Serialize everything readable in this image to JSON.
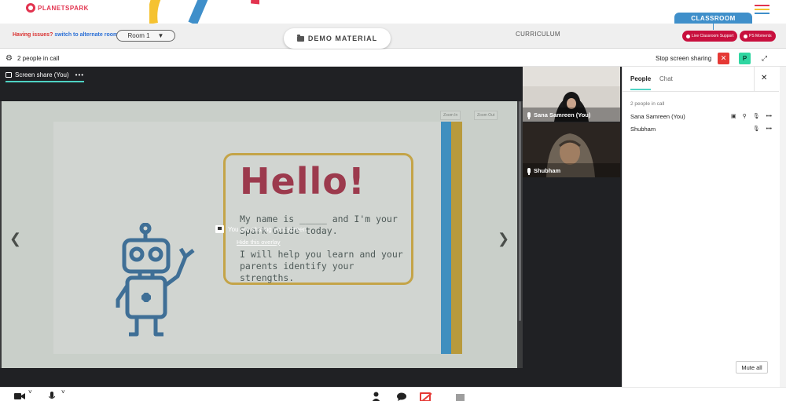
{
  "brand": {
    "name": "PLANETSPARK"
  },
  "colors": {
    "accent": "#4fd3c4",
    "brand_red": "#e2334f",
    "classroom_blue": "#3f8fca",
    "danger": "#e53935",
    "pill_red": "#c8103e",
    "stage_bg": "#202124"
  },
  "header": {
    "issues_text": "Having issues?",
    "switch_link": "switch to alternate room",
    "room_value": "Room 1",
    "room_chevron": "▼",
    "demo_material": "DEMO MATERIAL",
    "curriculum": "CURRICULUM",
    "classroom_tab": "CLASSROOM",
    "live_support": "Live Classroom Support",
    "ps_moments": "PS Moments",
    "menu_icon": "hamburger-icon"
  },
  "callbar": {
    "settings_icon": "⚙",
    "people_count": "2 people in call",
    "stop_sharing": "Stop screen sharing",
    "stop_x": "✕",
    "avatar_letter": "P",
    "expand_icon": "⤢"
  },
  "stage": {
    "tab_label": "Screen share (You)",
    "tab_more": "•••",
    "zoom_in": "Zoom In",
    "zoom_out": "Zoom Out",
    "slide": {
      "hello": "Hello!",
      "line1": "My name is _____ and I'm your",
      "line2": "Spark Guide today.",
      "line3": "I will help you learn and your parents identify your strengths."
    },
    "overlay_text": "You are sharing your screen",
    "hide_overlay": "Hide this overlay",
    "prev_icon": "❮",
    "next_icon": "❯"
  },
  "tiles": [
    {
      "name": "Sana Samreen (You)"
    },
    {
      "name": "Shubham"
    }
  ],
  "panel": {
    "tab_people": "People",
    "tab_chat": "Chat",
    "close_icon": "✕",
    "count_label": "2 people in call",
    "people": [
      {
        "name": "Sana Samreen (You)"
      },
      {
        "name": "Shubham"
      }
    ],
    "more": "•••",
    "mute_all": "Mute all"
  },
  "bottombar": {
    "camera_icon": "camera-icon",
    "chevron": "˅",
    "mic_icon": "mic-icon",
    "person_icon": "person-icon",
    "chat_icon": "chat-icon",
    "share_off_icon": "screen-share-off-icon",
    "stop_icon": "stop-icon"
  }
}
